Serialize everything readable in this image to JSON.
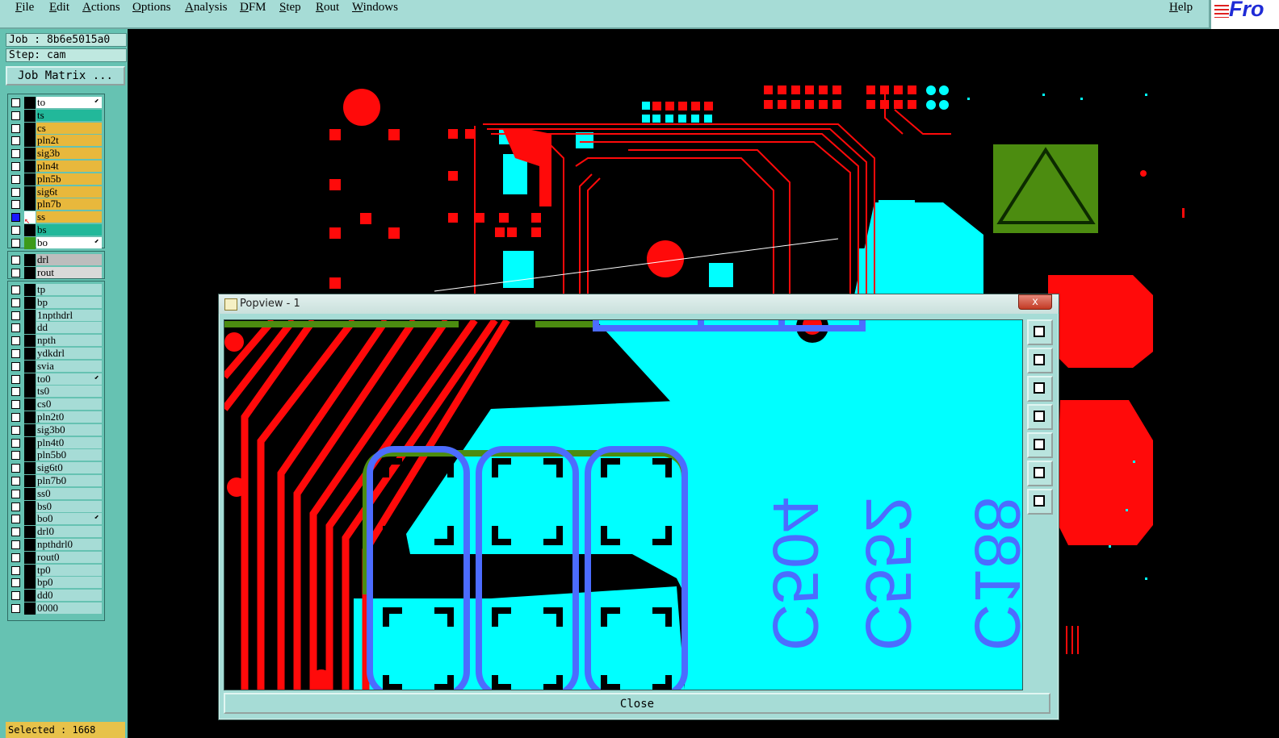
{
  "menubar": {
    "items": [
      "File",
      "Edit",
      "Actions",
      "Options",
      "Analysis",
      "DFM",
      "Step",
      "Rout",
      "Windows"
    ],
    "help": "Help",
    "logo_text": "Fro"
  },
  "job": {
    "job_label": "Job : 8b6e5015a0",
    "step_label": "Step: cam",
    "matrix_button": "Job Matrix ..."
  },
  "layers": {
    "group1": [
      {
        "name": "to",
        "color": "#ffffff",
        "arrow": true
      },
      {
        "name": "ts",
        "color": "#22b89a"
      },
      {
        "name": "cs",
        "color": "#e8b83c"
      },
      {
        "name": "pln2t",
        "color": "#e8b83c"
      },
      {
        "name": "sig3b",
        "color": "#e8b83c"
      },
      {
        "name": "pln4t",
        "color": "#e8b83c"
      },
      {
        "name": "pln5b",
        "color": "#e8b83c"
      },
      {
        "name": "sig6t",
        "color": "#e8b83c"
      },
      {
        "name": "pln7b",
        "color": "#e8b83c"
      },
      {
        "name": "ss",
        "color": "#e8b83c",
        "selected": true
      },
      {
        "name": "bs",
        "color": "#22b89a"
      },
      {
        "name": "bo",
        "color": "#ffffff",
        "arrow": true
      }
    ],
    "group2": [
      {
        "name": "drl",
        "color": "#bdbdbd"
      },
      {
        "name": "rout",
        "color": "#d9d9d9"
      }
    ],
    "group3": [
      {
        "name": "tp",
        "color": "#a6dcd6"
      },
      {
        "name": "bp",
        "color": "#a6dcd6"
      },
      {
        "name": "1npthdrl",
        "color": "#a6dcd6"
      },
      {
        "name": "dd",
        "color": "#a6dcd6"
      },
      {
        "name": "npth",
        "color": "#a6dcd6"
      },
      {
        "name": "ydkdrl",
        "color": "#a6dcd6"
      },
      {
        "name": "svia",
        "color": "#a6dcd6"
      },
      {
        "name": "to0",
        "color": "#a6dcd6",
        "arrow": true
      },
      {
        "name": "ts0",
        "color": "#a6dcd6"
      },
      {
        "name": "cs0",
        "color": "#a6dcd6"
      },
      {
        "name": "pln2t0",
        "color": "#a6dcd6"
      },
      {
        "name": "sig3b0",
        "color": "#a6dcd6"
      },
      {
        "name": "pln4t0",
        "color": "#a6dcd6"
      },
      {
        "name": "pln5b0",
        "color": "#a6dcd6"
      },
      {
        "name": "sig6t0",
        "color": "#a6dcd6"
      },
      {
        "name": "pln7b0",
        "color": "#a6dcd6"
      },
      {
        "name": "ss0",
        "color": "#a6dcd6"
      },
      {
        "name": "bs0",
        "color": "#a6dcd6"
      },
      {
        "name": "bo0",
        "color": "#a6dcd6",
        "arrow": true
      },
      {
        "name": "drl0",
        "color": "#a6dcd6"
      },
      {
        "name": "npthdrl0",
        "color": "#a6dcd6"
      },
      {
        "name": "rout0",
        "color": "#a6dcd6"
      },
      {
        "name": "tp0",
        "color": "#a6dcd6"
      },
      {
        "name": "bp0",
        "color": "#a6dcd6"
      },
      {
        "name": "dd0",
        "color": "#a6dcd6"
      },
      {
        "name": "0000",
        "color": "#a6dcd6"
      }
    ]
  },
  "status": {
    "selected": "Selected : 1668"
  },
  "popview": {
    "title": "Popview - 1",
    "close_x": "x",
    "close_button": "Close",
    "silkscreen": [
      "C504",
      "C552",
      "C188"
    ]
  },
  "colors": {
    "trace_red": "#ff0a0a",
    "pad_cyan": "#00ffff",
    "silk_blue": "#4c6cff",
    "mask_green": "#4c8c10",
    "panel_teal": "#66c2b2"
  }
}
